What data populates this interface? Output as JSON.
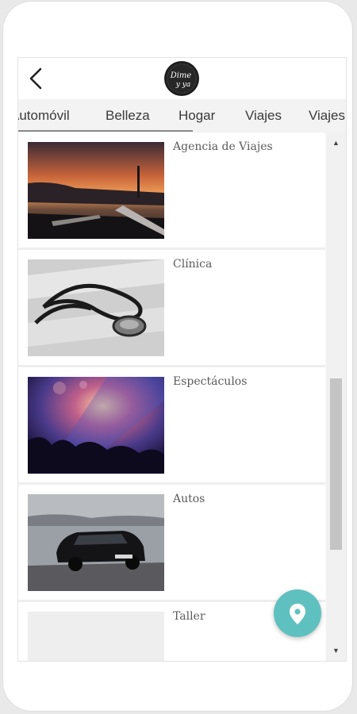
{
  "header": {
    "back_icon": "chevron-left-icon",
    "logo_text": "Dime y ya"
  },
  "tabs": {
    "items": [
      {
        "label": "Automóvil"
      },
      {
        "label": "Belleza"
      },
      {
        "label": "Hogar"
      },
      {
        "label": "Viajes"
      },
      {
        "label": "Viajes"
      }
    ]
  },
  "list": {
    "items": [
      {
        "title": "Agencia de Viajes",
        "image": "sunset-airplane-photo"
      },
      {
        "title": "Clínica",
        "image": "stethoscope-photo"
      },
      {
        "title": "Espectáculos",
        "image": "concert-crowd-photo"
      },
      {
        "title": "Autos",
        "image": "black-car-photo"
      },
      {
        "title": "Taller",
        "image": "blank-photo"
      }
    ]
  },
  "scrollbar": {
    "up_icon": "triangle-up-icon",
    "down_icon": "triangle-down-icon"
  },
  "fab": {
    "icon": "location-pin-icon",
    "color": "#5fc0c0"
  }
}
